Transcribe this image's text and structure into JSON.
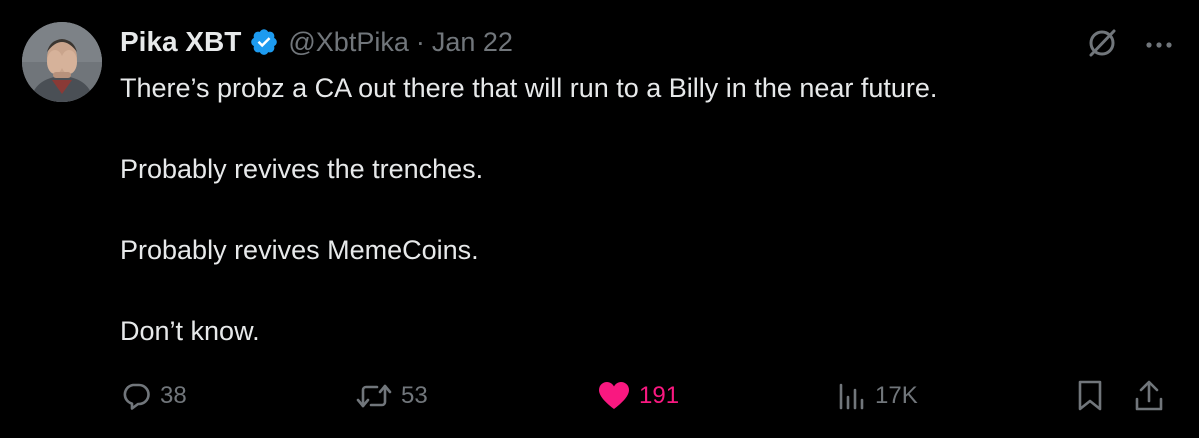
{
  "author": {
    "display_name": "Pika XBT",
    "handle": "@XbtPika",
    "separator": "·",
    "date": "Jan 22",
    "verified": true,
    "verified_color": "#1d9bf0"
  },
  "tweet": {
    "paragraphs": [
      "There’s probz a CA out there that will run to a Billy in the near future.",
      "Probably revives the trenches.",
      "Probably revives MemeCoins.",
      "Don’t know."
    ]
  },
  "header_icons": [
    "grok-icon",
    "more-icon"
  ],
  "actions": {
    "reply": {
      "icon": "reply-icon",
      "count": "38"
    },
    "repost": {
      "icon": "repost-icon",
      "count": "53"
    },
    "like": {
      "icon": "heart-icon",
      "count": "191",
      "active": true,
      "color": "#f91880"
    },
    "views": {
      "icon": "views-icon",
      "count": "17K"
    },
    "bookmark": {
      "icon": "bookmark-icon"
    },
    "share": {
      "icon": "share-icon"
    }
  },
  "colors": {
    "background": "#000000",
    "primary_text": "#e7e9ea",
    "secondary_text": "#71767b"
  }
}
